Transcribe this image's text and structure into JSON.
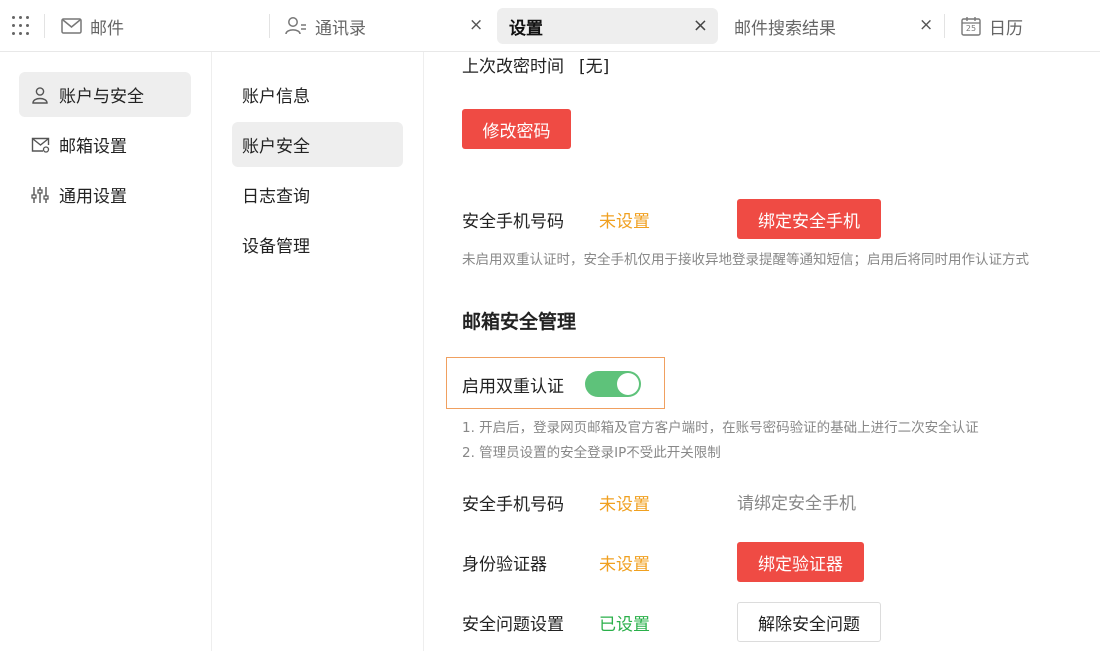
{
  "tabs": {
    "mail": "邮件",
    "contacts": "通讯录",
    "settings": "设置",
    "search_results": "邮件搜索结果",
    "calendar": "日历",
    "calendar_icon_day": "25",
    "close_glyph": "×"
  },
  "left_nav": {
    "items": [
      {
        "label": "账户与安全"
      },
      {
        "label": "邮箱设置"
      },
      {
        "label": "通用设置"
      }
    ]
  },
  "sub_nav": {
    "items": [
      {
        "label": "账户信息"
      },
      {
        "label": "账户安全"
      },
      {
        "label": "日志查询"
      },
      {
        "label": "设备管理"
      }
    ]
  },
  "main": {
    "last_password_change_label": "上次改密时间",
    "last_password_change_value": "[无]",
    "change_password_button": "修改密码",
    "phone_label": "安全手机号码",
    "phone_status": "未设置",
    "bind_phone_button": "绑定安全手机",
    "phone_note": "未启用双重认证时，安全手机仅用于接收异地登录提醒等通知短信；启用后将同时用作认证方式",
    "section_title": "邮箱安全管理",
    "twofa_label": "启用双重认证",
    "twofa_enabled": true,
    "twofa_note_1": "1. 开启后，登录网页邮箱及官方客户端时，在账号密码验证的基础上进行二次安全认证",
    "twofa_note_2": "2. 管理员设置的安全登录IP不受此开关限制",
    "phone2_label": "安全手机号码",
    "phone2_status": "未设置",
    "phone2_hint": "请绑定安全手机",
    "authenticator_label": "身份验证器",
    "authenticator_status": "未设置",
    "bind_authenticator_button": "绑定验证器",
    "question_label": "安全问题设置",
    "question_status": "已设置",
    "remove_question_button": "解除安全问题"
  },
  "colors": {
    "accent_red": "#ef4b44",
    "warning_orange": "#f0a020",
    "success_green": "#2ab04a",
    "toggle_green": "#5ec27a",
    "highlight_border": "#f0a060"
  }
}
